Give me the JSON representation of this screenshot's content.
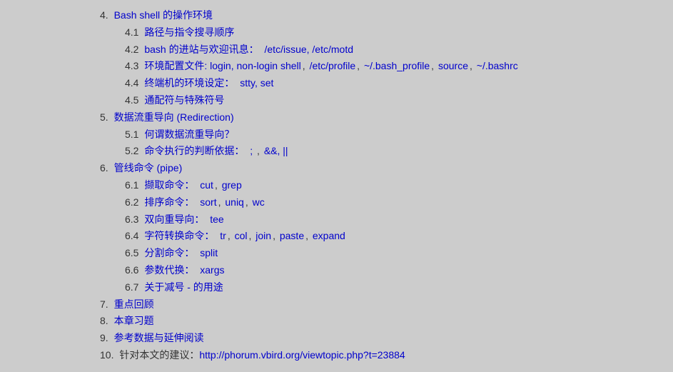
{
  "items": [
    {
      "num": "4.",
      "title": "Bash shell 的操作环境",
      "sub": [
        {
          "num": "4.1",
          "parts": [
            {
              "t": "link",
              "v": "路径与指令搜寻顺序"
            }
          ]
        },
        {
          "num": "4.2",
          "parts": [
            {
              "t": "link",
              "v": "bash 的进站与欢迎讯息："
            },
            {
              "t": "text",
              "v": " "
            },
            {
              "t": "link",
              "v": "/etc/issue, /etc/motd"
            }
          ]
        },
        {
          "num": "4.3",
          "parts": [
            {
              "t": "link",
              "v": "环境配置文件: login, non-login shell"
            },
            {
              "t": "text",
              "v": ", "
            },
            {
              "t": "link",
              "v": "/etc/profile"
            },
            {
              "t": "text",
              "v": ", "
            },
            {
              "t": "link",
              "v": "~/.bash_profile"
            },
            {
              "t": "text",
              "v": ", "
            },
            {
              "t": "link",
              "v": "source"
            },
            {
              "t": "text",
              "v": ", "
            },
            {
              "t": "link",
              "v": "~/.bashrc"
            }
          ]
        },
        {
          "num": "4.4",
          "parts": [
            {
              "t": "link",
              "v": "终端机的环境设定："
            },
            {
              "t": "text",
              "v": " "
            },
            {
              "t": "link",
              "v": "stty, set"
            }
          ]
        },
        {
          "num": "4.5",
          "parts": [
            {
              "t": "link",
              "v": "通配符与特殊符号"
            }
          ]
        }
      ]
    },
    {
      "num": "5.",
      "title": "数据流重导向 (Redirection)",
      "sub": [
        {
          "num": "5.1",
          "parts": [
            {
              "t": "link",
              "v": "何谓数据流重导向？"
            }
          ]
        },
        {
          "num": "5.2",
          "parts": [
            {
              "t": "link",
              "v": "命令执行的判断依据："
            },
            {
              "t": "text",
              "v": " "
            },
            {
              "t": "link",
              "v": ";"
            },
            {
              "t": "text",
              "v": " , "
            },
            {
              "t": "link",
              "v": "&&, ||"
            }
          ]
        }
      ]
    },
    {
      "num": "6.",
      "title": "管线命令 (pipe)",
      "sub": [
        {
          "num": "6.1",
          "parts": [
            {
              "t": "link",
              "v": "撷取命令："
            },
            {
              "t": "text",
              "v": " "
            },
            {
              "t": "link",
              "v": "cut"
            },
            {
              "t": "text",
              "v": ", "
            },
            {
              "t": "link",
              "v": "grep"
            }
          ]
        },
        {
          "num": "6.2",
          "parts": [
            {
              "t": "link",
              "v": "排序命令："
            },
            {
              "t": "text",
              "v": " "
            },
            {
              "t": "link",
              "v": "sort"
            },
            {
              "t": "text",
              "v": ", "
            },
            {
              "t": "link",
              "v": "uniq"
            },
            {
              "t": "text",
              "v": ", "
            },
            {
              "t": "link",
              "v": "wc"
            }
          ]
        },
        {
          "num": "6.3",
          "parts": [
            {
              "t": "link",
              "v": "双向重导向："
            },
            {
              "t": "text",
              "v": " "
            },
            {
              "t": "link",
              "v": "tee"
            }
          ]
        },
        {
          "num": "6.4",
          "parts": [
            {
              "t": "link",
              "v": "字符转换命令："
            },
            {
              "t": "text",
              "v": " "
            },
            {
              "t": "link",
              "v": "tr"
            },
            {
              "t": "text",
              "v": ", "
            },
            {
              "t": "link",
              "v": "col"
            },
            {
              "t": "text",
              "v": ", "
            },
            {
              "t": "link",
              "v": "join"
            },
            {
              "t": "text",
              "v": ", "
            },
            {
              "t": "link",
              "v": "paste"
            },
            {
              "t": "text",
              "v": ", "
            },
            {
              "t": "link",
              "v": "expand"
            }
          ]
        },
        {
          "num": "6.5",
          "parts": [
            {
              "t": "link",
              "v": "分割命令："
            },
            {
              "t": "text",
              "v": " "
            },
            {
              "t": "link",
              "v": "split"
            }
          ]
        },
        {
          "num": "6.6",
          "parts": [
            {
              "t": "link",
              "v": "参数代换："
            },
            {
              "t": "text",
              "v": " "
            },
            {
              "t": "link",
              "v": "xargs"
            }
          ]
        },
        {
          "num": "6.7",
          "parts": [
            {
              "t": "link",
              "v": "关于减号 - 的用途"
            }
          ]
        }
      ]
    },
    {
      "num": "7.",
      "title": "重点回顾",
      "sub": []
    },
    {
      "num": "8.",
      "title": "本章习题",
      "sub": []
    },
    {
      "num": "9.",
      "title": "参考数据与延伸阅读",
      "sub": []
    }
  ],
  "item10": {
    "num": "10.",
    "text": "针对本文的建议：",
    "url": "http://phorum.vbird.org/viewtopic.php?t=23884"
  }
}
